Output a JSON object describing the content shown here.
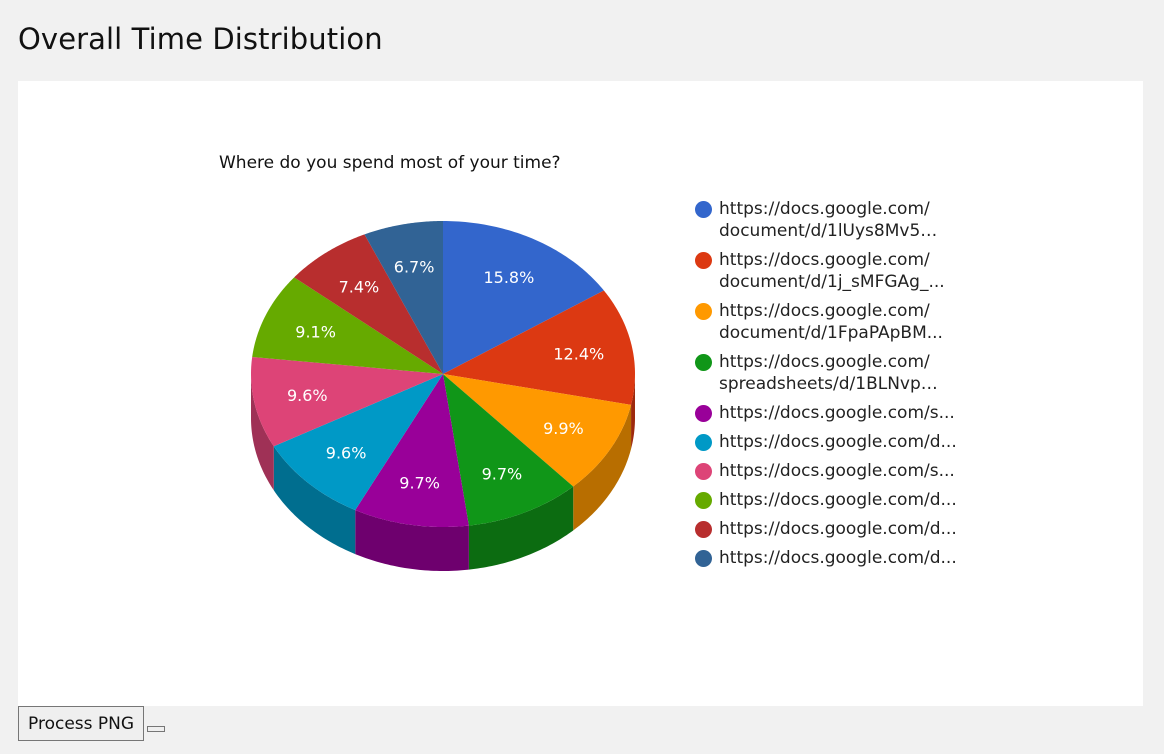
{
  "page": {
    "title": "Overall Time Distribution"
  },
  "chart_data": {
    "type": "pie",
    "title": "Where do you spend most of your time?",
    "is_3d": true,
    "legend_position": "right",
    "slices": [
      {
        "legend_line1": "https://docs.google.com/",
        "legend_line2": "document/d/1lUys8Mv56j...",
        "value": 15.8,
        "label": "15.8%",
        "color": "#3366cc"
      },
      {
        "legend_line1": "https://docs.google.com/",
        "legend_line2": "document/d/1j_sMFGAg_...",
        "value": 12.4,
        "label": "12.4%",
        "color": "#dc3912"
      },
      {
        "legend_line1": "https://docs.google.com/",
        "legend_line2": "document/d/1FpaPApBM...",
        "value": 9.9,
        "label": "9.9%",
        "color": "#ff9900"
      },
      {
        "legend_line1": "https://docs.google.com/",
        "legend_line2": "spreadsheets/d/1BLNvp57...",
        "value": 9.7,
        "label": "9.7%",
        "color": "#109618"
      },
      {
        "legend_line1": "https://docs.google.com/s...",
        "legend_line2": "",
        "value": 9.7,
        "label": "9.7%",
        "color": "#990099"
      },
      {
        "legend_line1": "https://docs.google.com/d...",
        "legend_line2": "",
        "value": 9.6,
        "label": "9.6%",
        "color": "#0099c6"
      },
      {
        "legend_line1": "https://docs.google.com/s...",
        "legend_line2": "",
        "value": 9.6,
        "label": "9.6%",
        "color": "#dd4477"
      },
      {
        "legend_line1": "https://docs.google.com/d...",
        "legend_line2": "",
        "value": 9.1,
        "label": "9.1%",
        "color": "#66aa00"
      },
      {
        "legend_line1": "https://docs.google.com/d...",
        "legend_line2": "",
        "value": 7.4,
        "label": "7.4%",
        "color": "#b82e2e"
      },
      {
        "legend_line1": "https://docs.google.com/d...",
        "legend_line2": "",
        "value": 6.7,
        "label": "6.7%",
        "color": "#316395"
      }
    ]
  },
  "buttons": {
    "process_png": "Process PNG",
    "secondary": ""
  }
}
